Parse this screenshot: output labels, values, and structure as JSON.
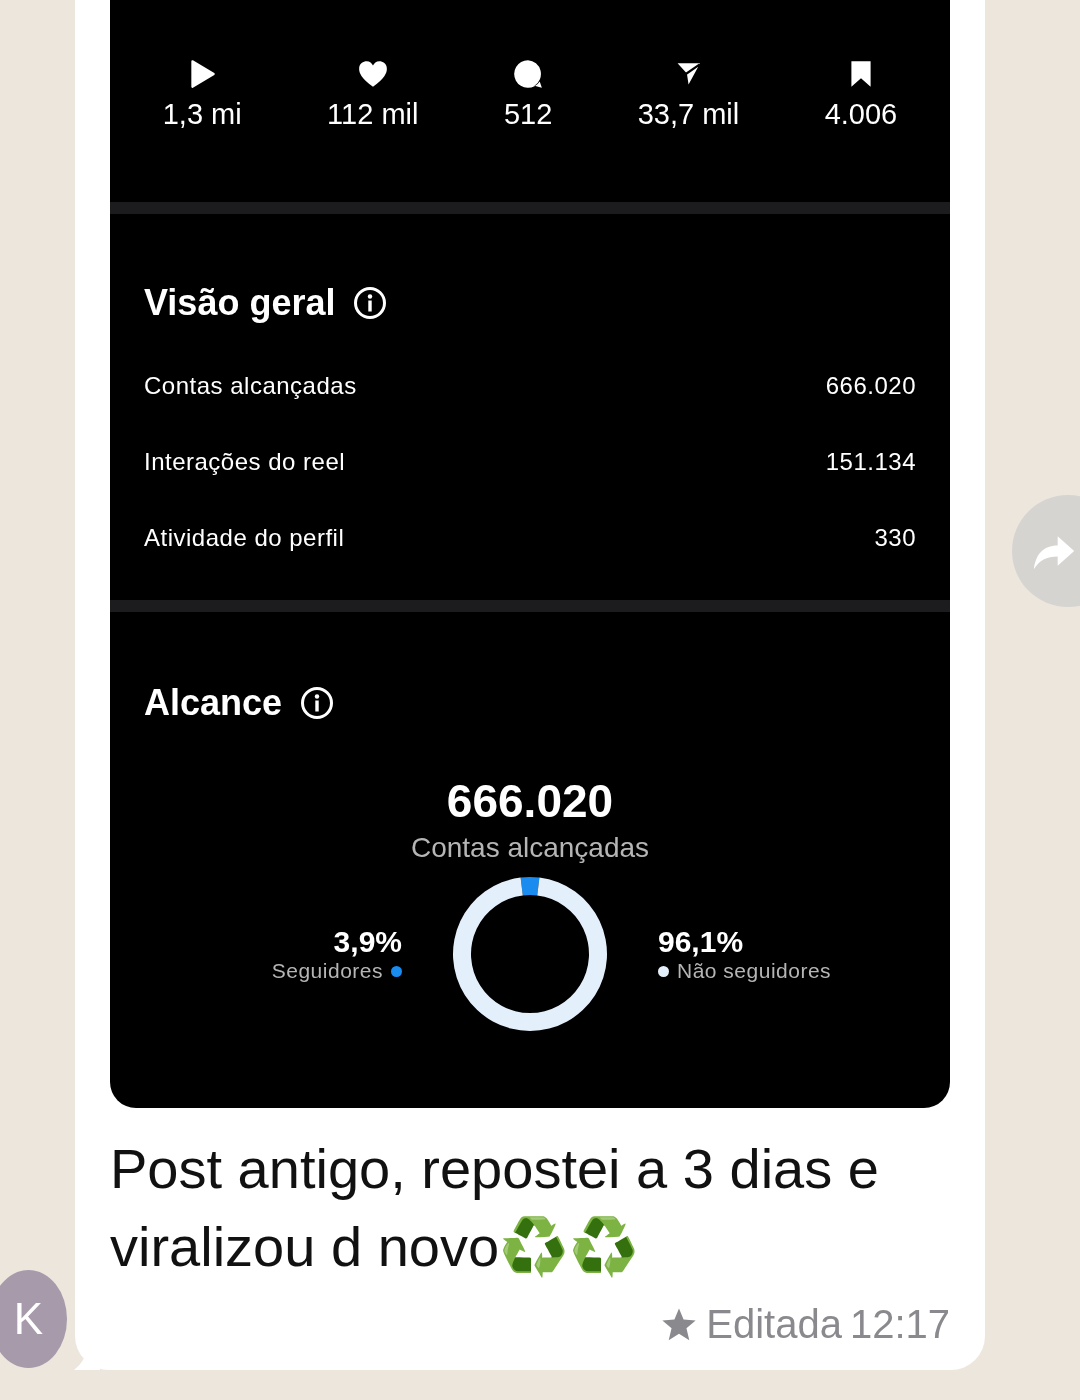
{
  "stats": [
    {
      "kind": "play",
      "value": "1,3 mi"
    },
    {
      "kind": "heart",
      "value": "112 mil"
    },
    {
      "kind": "comment",
      "value": "512"
    },
    {
      "kind": "share",
      "value": "33,7 mil"
    },
    {
      "kind": "save",
      "value": "4.006"
    }
  ],
  "overview": {
    "title": "Visão geral",
    "rows": [
      {
        "label": "Contas alcançadas",
        "value": "666.020"
      },
      {
        "label": "Interações do reel",
        "value": "151.134"
      },
      {
        "label": "Atividade do perfil",
        "value": "330"
      }
    ]
  },
  "reach": {
    "title": "Alcance",
    "total": "666.020",
    "subtitle": "Contas alcançadas",
    "legend": [
      {
        "percent": "3,9%",
        "color": "#1a8cf0"
      },
      {
        "percent": "96,1%",
        "color": "#e3f0fb"
      }
    ],
    "chart_data": {
      "type": "donut",
      "categories": [
        "Seguidores",
        "Não seguidores"
      ],
      "values": [
        3.9,
        96.1
      ]
    }
  },
  "message": {
    "text": "Post antigo, repostei a 3 dias e viralizou d novo",
    "emoji": "♻️♻️",
    "status": "Editada",
    "time": "12:17",
    "starred": true
  },
  "avatar": {
    "initial": "K"
  }
}
